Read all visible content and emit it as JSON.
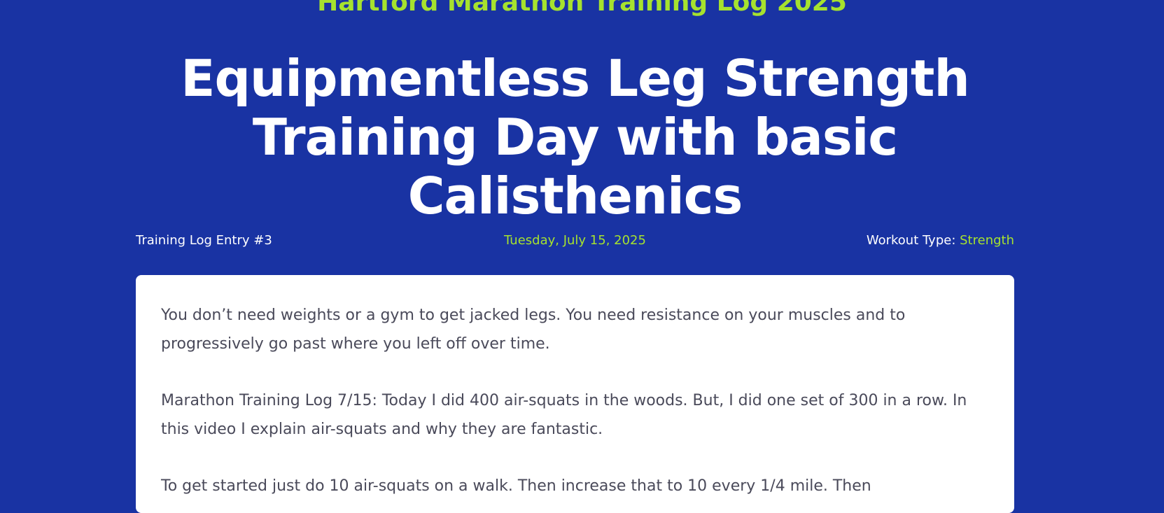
{
  "site": {
    "title": "Hartford Marathon Training Log 2025"
  },
  "post": {
    "title": "Equipmentless Leg Strength Training Day with basic Calisthenics",
    "entry_label": "Training Log Entry #3",
    "date": "Tuesday, July 15, 2025",
    "workout_type_label": "Workout Type:",
    "workout_type_value": "Strength",
    "paragraphs": [
      "You don’t need weights or a gym to get jacked legs. You need resistance on your muscles and to progressively go past where you left off over time.",
      "Marathon Training Log 7/15: Today I did 400 air-squats in the woods. But, I did one set of 300 in a row. In this video I explain air-squats and why they are fantastic.",
      "To get started just do 10 air-squats on a walk. Then increase that to 10 every 1/4 mile. Then"
    ]
  },
  "colors": {
    "background": "#1933a3",
    "accent": "#a6e22e",
    "heading_text": "#ffffff",
    "body_text": "#4a4a5a",
    "card": "#ffffff"
  }
}
